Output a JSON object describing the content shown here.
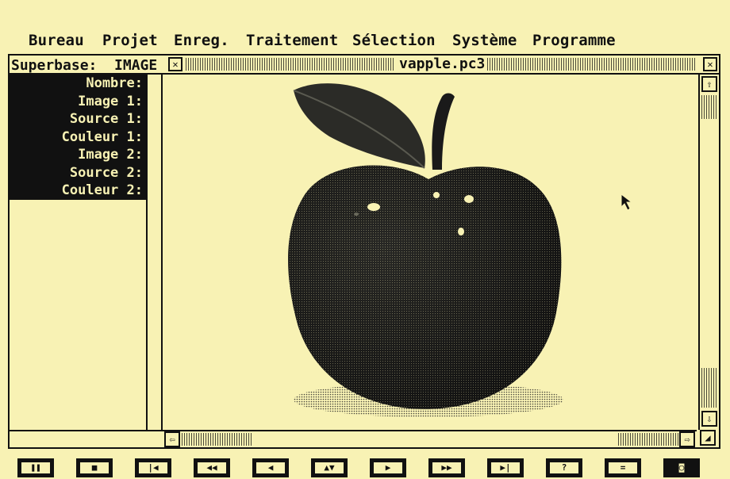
{
  "menu": {
    "items": [
      "Bureau",
      "Projet",
      "Enreg.",
      "Traitement",
      "Sélection",
      "Système",
      "Programme"
    ]
  },
  "window": {
    "db_label": "Superbase:  IMAGE",
    "filename": "vapple.pc3"
  },
  "record_fields": [
    "Nombre:",
    "Image 1:",
    "Source 1:",
    "Couleur 1:",
    "Image 2:",
    "Source 2:",
    "Couleur 2:"
  ],
  "image": {
    "subject": "apple with leaf and stem",
    "apple_color": "#1c1c1c",
    "highlight_color": "#f8f2b4"
  },
  "icons": {
    "close": "close-box-icon",
    "full": "full-box-icon",
    "up": "arrow-up-icon",
    "down": "arrow-down-icon",
    "left": "arrow-left-icon",
    "right": "arrow-right-icon",
    "resize": "resize-icon"
  },
  "toolbar": [
    {
      "name": "pause-button",
      "glyph": "❚❚"
    },
    {
      "name": "stop-button",
      "glyph": "■"
    },
    {
      "name": "first-record-button",
      "glyph": "|◀"
    },
    {
      "name": "fast-rewind-button",
      "glyph": "◀◀"
    },
    {
      "name": "previous-record-button",
      "glyph": "◀"
    },
    {
      "name": "up-down-button",
      "glyph": "▲▼"
    },
    {
      "name": "next-record-button",
      "glyph": "▶"
    },
    {
      "name": "fast-forward-button",
      "glyph": "▶▶"
    },
    {
      "name": "last-record-button",
      "glyph": "▶|"
    },
    {
      "name": "help-button",
      "glyph": "?"
    },
    {
      "name": "equals-button",
      "glyph": "="
    },
    {
      "name": "camera-button",
      "glyph": "◙"
    }
  ],
  "colors": {
    "background": "#f8f2b4",
    "ink": "#111111"
  }
}
